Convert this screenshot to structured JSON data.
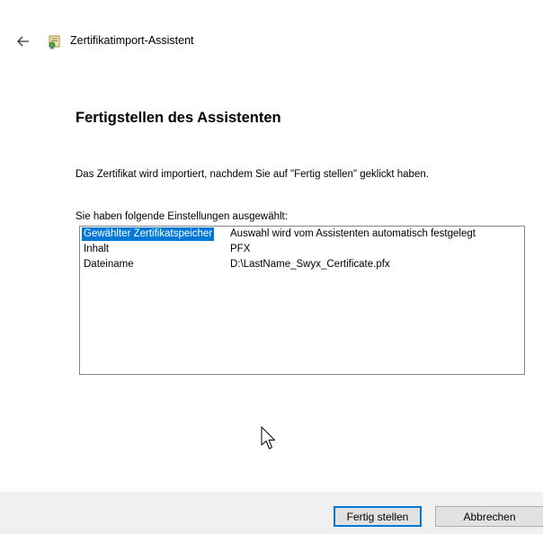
{
  "window": {
    "title": "Zertifikatimport-Assistent",
    "back_icon": "arrow-left-icon",
    "app_icon": "certificate-icon"
  },
  "page": {
    "heading": "Fertigstellen des Assistenten",
    "intro": "Das Zertifikat wird importiert, nachdem Sie auf \"Fertig stellen\" geklickt haben.",
    "settings_label": "Sie haben folgende Einstellungen ausgewählt:"
  },
  "settings": [
    {
      "key": "Gewählter Zertifikatspeicher",
      "value": "Auswahl wird vom Assistenten automatisch festgelegt",
      "selected": true
    },
    {
      "key": "Inhalt",
      "value": "PFX",
      "selected": false
    },
    {
      "key": "Dateiname",
      "value": "D:\\LastName_Swyx_Certificate.pfx",
      "selected": false
    }
  ],
  "buttons": {
    "finish": "Fertig stellen",
    "cancel": "Abbrechen"
  },
  "colors": {
    "selection": "#0078d7",
    "footer_bg": "#f0f0f0",
    "default_button_border": "#0078d7"
  }
}
